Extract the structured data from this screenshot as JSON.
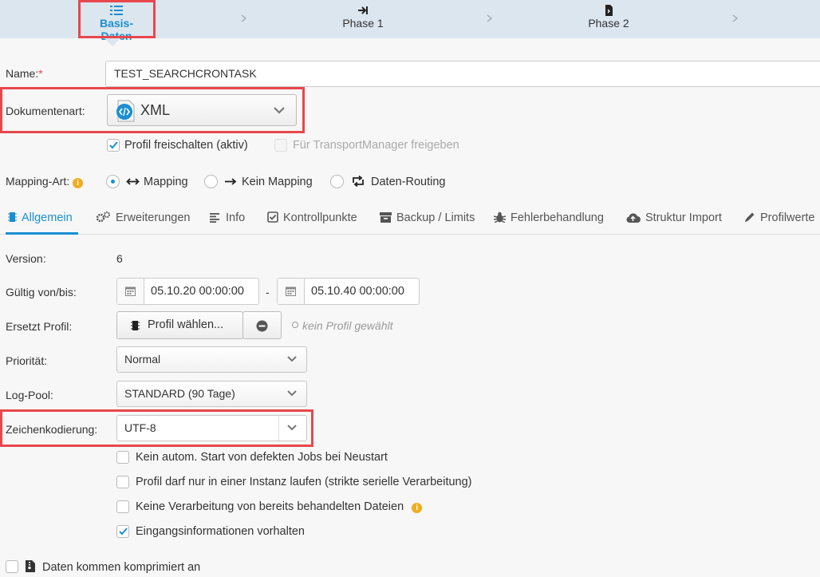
{
  "wizard": {
    "steps": [
      {
        "label": "Basis-Daten",
        "icon": "list-icon",
        "active": true
      },
      {
        "label": "Phase 1",
        "icon": "arrow-right-to-line-icon",
        "active": false
      },
      {
        "label": "Phase 2",
        "icon": "file-icon",
        "active": false
      }
    ]
  },
  "form": {
    "name_label": "Name:",
    "name_required": "*",
    "name_value": "TEST_SEARCHCRONTASK",
    "doctype_label": "Dokumentenart:",
    "doctype_value": "XML",
    "profile_active_label": "Profil freischalten (aktiv)",
    "transport_label": "Für TransportManager freigeben",
    "mapping_label": "Mapping-Art:",
    "mapping_options": [
      "Mapping",
      "Kein Mapping",
      "Daten-Routing"
    ]
  },
  "tabs": [
    "Allgemein",
    "Erweiterungen",
    "Info",
    "Kontrollpunkte",
    "Backup / Limits",
    "Fehlerbehandlung",
    "Struktur Import",
    "Profilwerte"
  ],
  "general": {
    "version_label": "Version:",
    "version_value": "6",
    "valid_label": "Gültig von/bis:",
    "valid_from": "05.10.20 00:00:00",
    "valid_sep": "-",
    "valid_to": "05.10.40 00:00:00",
    "replaces_label": "Ersetzt Profil:",
    "choose_profile": "Profil wählen...",
    "no_profile": "kein Profil gewählt",
    "priority_label": "Priorität:",
    "priority_value": "Normal",
    "logpool_label": "Log-Pool:",
    "logpool_value": "STANDARD (90 Tage)",
    "encoding_label": "Zeichenkodierung:",
    "encoding_value": "UTF-8",
    "options": [
      {
        "label": "Kein autom. Start von defekten Jobs bei Neustart",
        "checked": false
      },
      {
        "label": "Profil darf nur in einer Instanz laufen (strikte serielle Verarbeitung)",
        "checked": false
      },
      {
        "label": "Keine Verarbeitung von bereits behandelten Dateien",
        "checked": false
      },
      {
        "label": "Eingangsinformationen vorhalten",
        "checked": true
      }
    ],
    "compressed_label": "Daten kommen komprimiert an"
  },
  "colors": {
    "accent": "#1a8fd1",
    "highlight": "#e8474c",
    "info": "#f0ad1e"
  }
}
